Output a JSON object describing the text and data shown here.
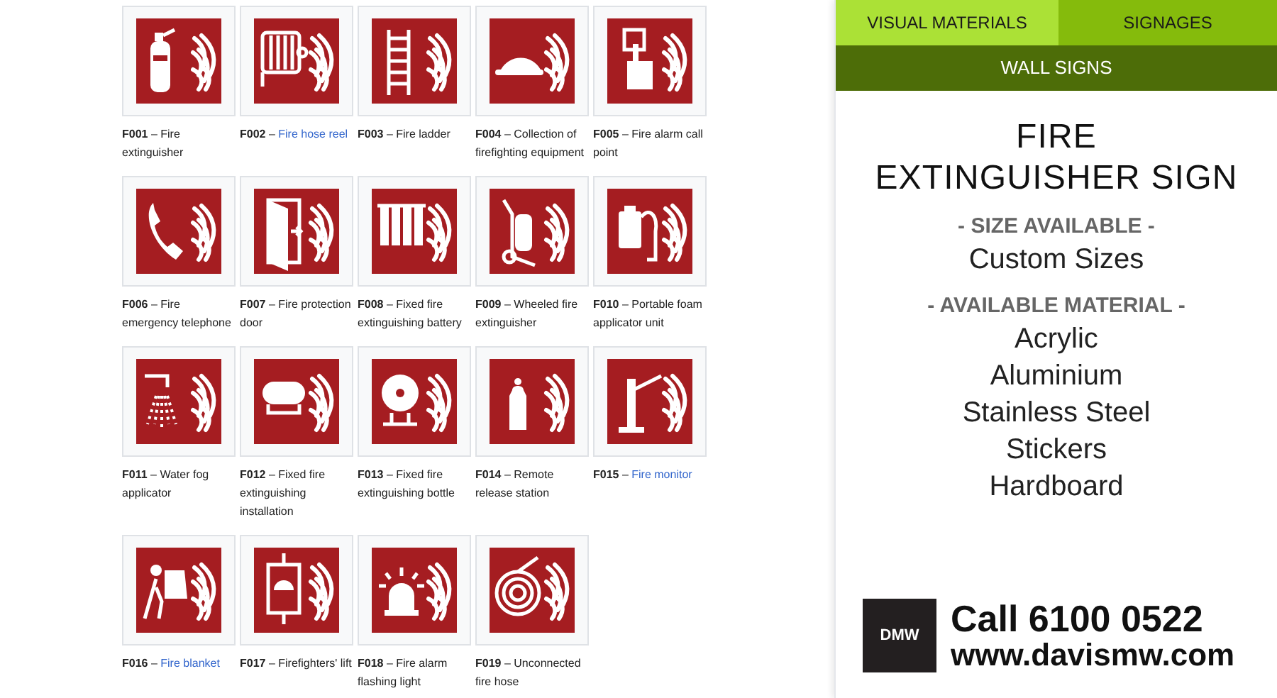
{
  "tabs": [
    {
      "label": "VISUAL MATERIALS",
      "selected": true
    },
    {
      "label": "SIGNAGES",
      "selected": false
    }
  ],
  "subcategory": "WALL SIGNS",
  "gallery": {
    "separator": "–",
    "items": [
      {
        "code": "F001",
        "text": "Fire extinguisher",
        "link": false
      },
      {
        "code": "F002",
        "text": "Fire hose reel",
        "link": true
      },
      {
        "code": "F003",
        "text": "Fire ladder",
        "link": false
      },
      {
        "code": "F004",
        "text": "Collection of firefighting equipment",
        "link": false
      },
      {
        "code": "F005",
        "text": "Fire alarm call point",
        "link": false
      },
      {
        "code": "F006",
        "text": "Fire emergency telephone",
        "link": false
      },
      {
        "code": "F007",
        "text": "Fire protection door",
        "link": false
      },
      {
        "code": "F008",
        "text": "Fixed fire extinguishing battery",
        "link": false
      },
      {
        "code": "F009",
        "text": "Wheeled fire extinguisher",
        "link": false
      },
      {
        "code": "F010",
        "text": "Portable foam applicator unit",
        "link": false
      },
      {
        "code": "F011",
        "text": "Water fog applicator",
        "link": false
      },
      {
        "code": "F012",
        "text": "Fixed fire extinguishing installation",
        "link": false
      },
      {
        "code": "F013",
        "text": "Fixed fire extinguishing bottle",
        "link": false
      },
      {
        "code": "F014",
        "text": "Remote release station",
        "link": false
      },
      {
        "code": "F015",
        "text": "Fire monitor",
        "link": true
      },
      {
        "code": "F016",
        "text": "Fire blanket",
        "link": true
      },
      {
        "code": "F017",
        "text": "Firefighters' lift",
        "link": false
      },
      {
        "code": "F018",
        "text": "Fire alarm flashing light",
        "link": false
      },
      {
        "code": "F019",
        "text": "Unconnected fire hose",
        "link": false
      }
    ]
  },
  "product": {
    "title_lines": [
      "FIRE",
      "EXTINGUISHER SIGN"
    ],
    "size_heading": "- SIZE AVAILABLE -",
    "sizes": [
      "Custom Sizes"
    ],
    "material_heading": "- AVAILABLE MATERIAL -",
    "materials": [
      "Acrylic",
      "Aluminium",
      "Stainless Steel",
      "Stickers",
      "Hardboard"
    ]
  },
  "contact": {
    "logo": "DMW",
    "phone": "Call 6100 0522",
    "website": "www.davismw.com"
  }
}
